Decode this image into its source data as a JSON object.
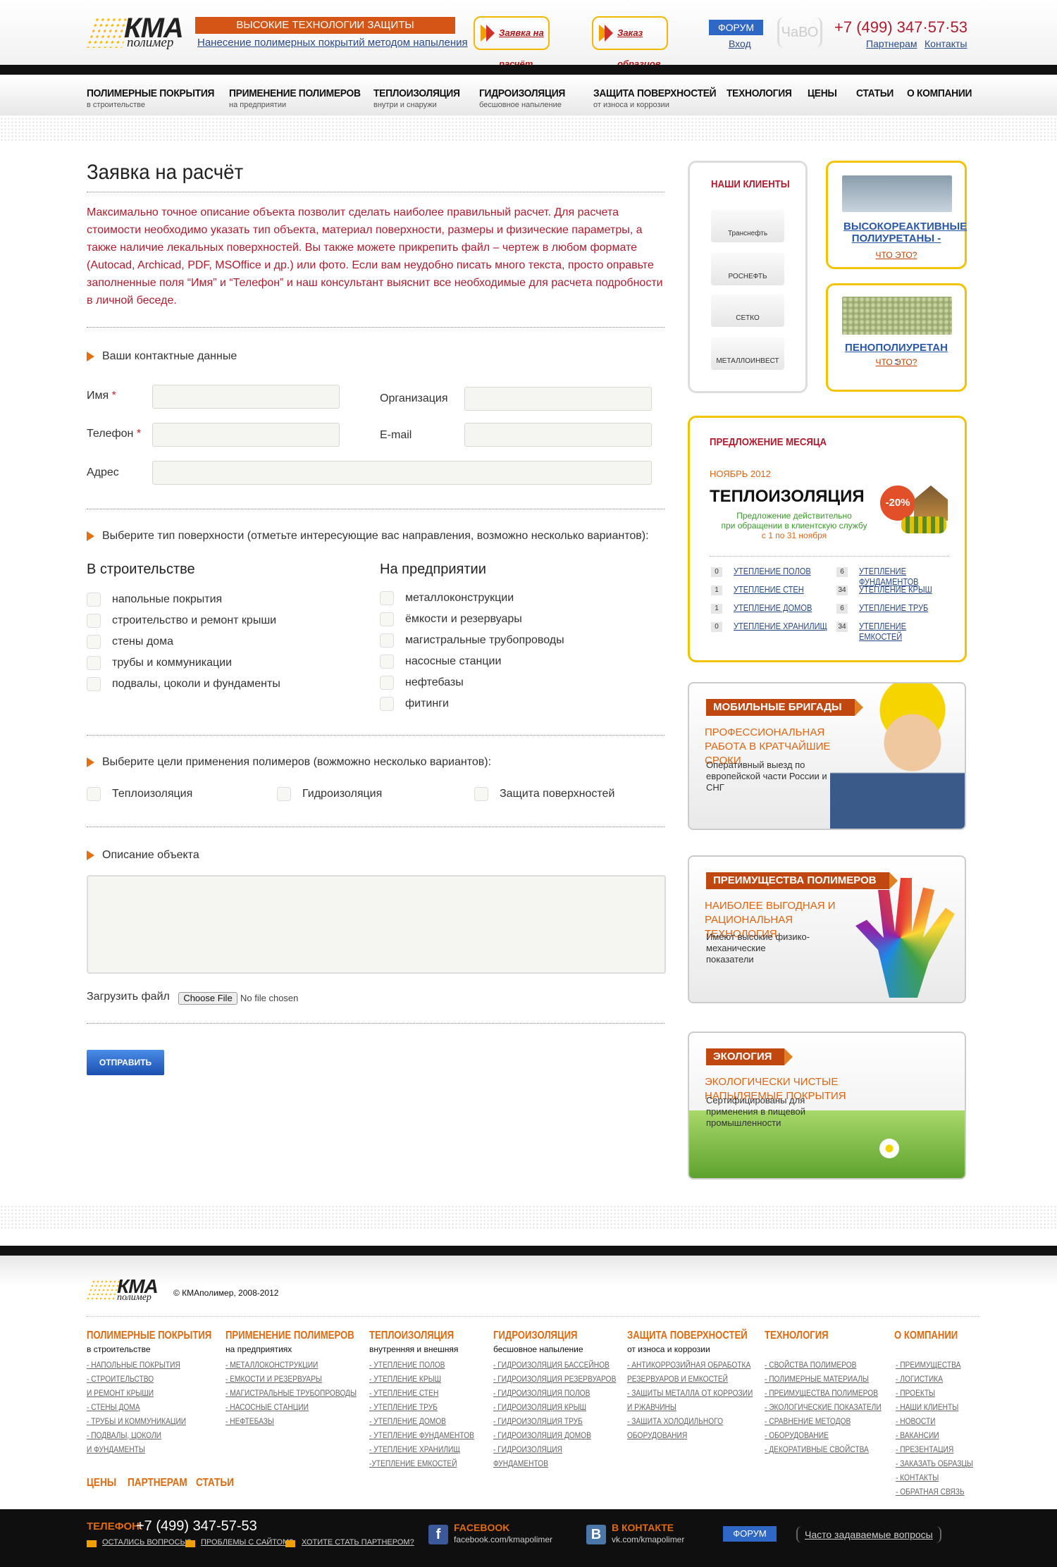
{
  "header": {
    "logo": "КМА",
    "logo_sub": "полимер",
    "slogan": "ВЫСОКИЕ ТЕХНОЛОГИИ ЗАЩИТЫ ПОВЕРХНОСТЕЙ",
    "subslogan": "Нанесение полимерных покрытий методом напыления",
    "btn_request": "Заявка на расчёт",
    "btn_samples": "Заказ образцов",
    "forum": "ФОРУМ",
    "login": "Вход",
    "faq": "ЧаВО",
    "phone": "+7 (499) 347·57·53",
    "partners": "Партнерам",
    "contacts": "Контакты"
  },
  "nav": [
    {
      "label": "ПОЛИМЕРНЫЕ ПОКРЫТИЯ",
      "sub": "в строительстве"
    },
    {
      "label": "ПРИМЕНЕНИЕ ПОЛИМЕРОВ",
      "sub": "на предприятии"
    },
    {
      "label": "ТЕПЛОИЗОЛЯЦИЯ",
      "sub": "внутри и снаружи"
    },
    {
      "label": "ГИДРОИЗОЛЯЦИЯ",
      "sub": "бесшовное напыление"
    },
    {
      "label": "ЗАЩИТА ПОВЕРХНОСТЕЙ",
      "sub": "от износа и коррозии"
    },
    {
      "label": "ТЕХНОЛОГИЯ",
      "sub": ""
    },
    {
      "label": "ЦЕНЫ",
      "sub": ""
    },
    {
      "label": "СТАТЬИ",
      "sub": ""
    },
    {
      "label": "О КОМПАНИИ",
      "sub": ""
    }
  ],
  "form": {
    "title": "Заявка на расчёт",
    "intro": "Максимально точное описание объекта позволит сделать наиболее правильный расчет. Для расчета стоимости необходимо указать тип объекта, материал поверхности, размеры и физические параметры, а также наличие лекальных поверхностей. Вы также можете прикрепить файл – чертеж в любом формате (Autocad, Archicad, PDF, MSOffice и др.) или фото. Если вам неудобно писать много текста, просто оправьте заполненные поля “Имя” и “Телефон” и наш консультант выяснит все необходимые для расчета подробности в личной беседе.",
    "contact_section": "Ваши контактные данные",
    "name": "Имя",
    "phone": "Телефон",
    "org": "Организация",
    "email": "E-mail",
    "address": "Адрес",
    "required_mark": "*",
    "surface_section": "Выберите тип поверхности (отметьте интересующие вас направления, возможно несколько вариантов):",
    "col1_title": "В строительстве",
    "col1": [
      "напольные покрытия",
      "строительство и ремонт крыши",
      "стены дома",
      "трубы и коммуникации",
      "подвалы, цоколи и фундаменты"
    ],
    "col2_title": "На предприятии",
    "col2": [
      "металлоконструкции",
      "ёмкости и резервуары",
      "магистральные трубопроводы",
      "насосные станции",
      "нефтебазы",
      "фитинги"
    ],
    "goals_section": "Выберите цели применения полимеров (вожможно несколько вариантов):",
    "goals": [
      "Теплоизоляция",
      "Гидроизоляция",
      "Защита поверхностей"
    ],
    "descr_section": "Описание объекта",
    "upload_label": "Загрузить файл",
    "choose_file": "Choose File",
    "no_file": "No file chosen",
    "submit": "ОТПРАВИТЬ"
  },
  "sidebar": {
    "clients_title": "НАШИ КЛИЕНТЫ",
    "clients": [
      "Транснефть",
      "РОСНЕФТЬ",
      "СЕТКО",
      "МЕТАЛЛОИНВЕСТ"
    ],
    "card1_title": "ВЫСОКОРЕАКТИВНЫЕ ПОЛИУРЕТАНЫ -",
    "card1_link": "ЧТО ЭТО?",
    "card2_title": "ПЕНОПОЛИУРЕТАН -",
    "card2_link": "ЧТО ЭТО?",
    "offer_title": "ПРЕДЛОЖЕНИЕ МЕСЯЦА",
    "offer_month": "НОЯБРЬ 2012",
    "offer_head": "ТЕПЛОИЗОЛЯЦИЯ",
    "offer_discount": "-20%",
    "offer_text1": "Предложение действительно",
    "offer_text2": "при обращении в клиентскую службу",
    "offer_text3": "с 1 по 31 ноября",
    "offer_links": [
      {
        "n": "0",
        "t": "УТЕПЛЕНИЕ ПОЛОВ"
      },
      {
        "n": "6",
        "t": "УТЕПЛЕНИЕ ФУНДАМЕНТОВ"
      },
      {
        "n": "1",
        "t": "УТЕПЛЕНИЕ СТЕН"
      },
      {
        "n": "34",
        "t": "УТЕПЛЕНИЕ КРЫШ"
      },
      {
        "n": "1",
        "t": "УТЕПЛЕНИЕ ДОМОВ"
      },
      {
        "n": "6",
        "t": "УТЕПЛЕНИЕ ТРУБ"
      },
      {
        "n": "0",
        "t": "УТЕПЛЕНИЕ ХРАНИЛИЩ"
      },
      {
        "n": "34",
        "t": "УТЕПЛЕНИЕ ЕМКОСТЕЙ"
      }
    ],
    "promo1": {
      "tag": "МОБИЛЬНЫЕ БРИГАДЫ",
      "head": "ПРОФЕССИОНАЛЬНАЯ РАБОТА В КРАТЧАЙШИЕ СРОКИ",
      "text": "Оперативный выезд по европейской части России и СНГ"
    },
    "promo2": {
      "tag": "ПРЕИМУЩЕСТВА ПОЛИМЕРОВ",
      "head": "НАИБОЛЕЕ ВЫГОДНАЯ И РАЦИОНАЛЬНАЯ ТЕХНОЛОГИЯ",
      "text": "Имеют высокие физико-механические показатели"
    },
    "promo3": {
      "tag": "ЭКОЛОГИЯ",
      "head": "ЭКОЛОГИЧЕСКИ ЧИСТЫЕ НАПЫЛЯЕМЫЕ ПОКРЫТИЯ",
      "text": "Сертифицированы для применения в пищевой промышленности"
    }
  },
  "footer": {
    "copyright": "© КМАполимер, 2008-2012",
    "cols": [
      {
        "title": "ПОЛИМЕРНЫЕ ПОКРЫТИЯ",
        "sub": "в строительстве",
        "links": [
          "- НАПОЛЬНЫЕ ПОКРЫТИЯ",
          "- СТРОИТЕЛЬСТВО",
          "И РЕМОНТ КРЫШИ",
          "- СТЕНЫ ДОМА",
          "- ТРУБЫ И КОММУНИКАЦИИ",
          "- ПОДВАЛЫ, ЦОКОЛИ",
          "И ФУНДАМЕНТЫ"
        ]
      },
      {
        "title": "ПРИМЕНЕНИЕ ПОЛИМЕРОВ",
        "sub": "на предприятиях",
        "links": [
          "- МЕТАЛЛОКОНСТРУКЦИИ",
          "- ЕМКОСТИ И РЕЗЕРВУАРЫ",
          "- МАГИСТРАЛЬНЫЕ ТРУБОПРОВОДЫ",
          "- НАСОСНЫЕ СТАНЦИИ",
          "- НЕФТЕБАЗЫ"
        ]
      },
      {
        "title": "ТЕПЛОИЗОЛЯЦИЯ",
        "sub": "внутренняя и внешняя",
        "links": [
          "- УТЕПЛЕНИЕ ПОЛОВ",
          "- УТЕПЛЕНИЕ КРЫШ",
          "- УТЕПЛЕНИЕ СТЕН",
          "- УТЕПЛЕНИЕ ТРУБ",
          "- УТЕПЛЕНИЕ ДОМОВ",
          "- УТЕПЛЕНИЕ ФУНДАМЕНТОВ",
          "- УТЕПЛЕНИЕ ХРАНИЛИЩ",
          "-УТЕПЛЕНИЕ ЕМКОСТЕЙ"
        ]
      },
      {
        "title": "ГИДРОИЗОЛЯЦИЯ",
        "sub": "бесшовное напыление",
        "links": [
          "- ГИДРОИЗОЛЯЦИЯ БАССЕЙНОВ",
          "- ГИДРОИЗОЛЯЦИЯ РЕЗЕРВУАРОВ",
          "- ГИДРОИЗОЛЯЦИЯ ПОЛОВ",
          "- ГИДРОИЗОЛЯЦИЯ КРЫШ",
          "- ГИДРОИЗОЛЯЦИЯ ТРУБ",
          "- ГИДРОИЗОЛЯЦИЯ ДОМОВ",
          "- ГИДРОИЗОЛЯЦИЯ",
          "ФУНДАМЕНТОВ"
        ]
      },
      {
        "title": "ЗАЩИТА ПОВЕРХНОСТЕЙ",
        "sub": "от износа и коррозии",
        "links": [
          "- АНТИКОРРОЗИЙНАЯ ОБРАБОТКА",
          "РЕЗЕРВУАРОВ И ЕМКОСТЕЙ",
          "- ЗАЩИТЫ МЕТАЛЛА ОТ КОРРОЗИИ",
          "И РЖАВЧИНЫ",
          "- ЗАЩИТА ХОЛОДИЛЬНОГО",
          "ОБОРУДОВАНИЯ"
        ]
      },
      {
        "title": "ТЕХНОЛОГИЯ",
        "sub": "",
        "links": [
          "- СВОЙСТВА ПОЛИМЕРОВ",
          "- ПОЛИМЕРНЫЕ МАТЕРИАЛЫ",
          "- ПРЕИМУЩЕСТВА ПОЛИМЕРОВ",
          "- ЭКОЛОГИЧЕСКИЕ ПОКАЗАТЕЛИ",
          "- СРАВНЕНИЕ МЕТОДОВ",
          "- ОБОРУДОВАНИЕ",
          "- ДЕКОРАТИВНЫЕ СВОЙСТВА"
        ]
      },
      {
        "title": "О КОМПАНИИ",
        "sub": "",
        "links": [
          "- ПРЕИМУЩЕСТВА",
          "- ЛОГИСТИКА",
          "- ПРОЕКТЫ",
          "- НАШИ КЛИЕНТЫ",
          "- НОВОСТИ",
          "- ВАКАНСИИ",
          "- ПРЕЗЕНТАЦИЯ",
          "- ЗАКАЗАТЬ ОБРАЗЦЫ",
          "- КОНТАКТЫ",
          "- ОБРАТНАЯ СВЯЗЬ"
        ]
      }
    ],
    "bottom_links": [
      "ЦЕНЫ",
      "ПАРТНЕРАМ",
      "СТАТЬИ"
    ],
    "phone_label": "ТЕЛЕФОН:",
    "phone": "+7 (499) 347-57-53",
    "mail1": "ОСТАЛИСЬ ВОПРОСЫ?",
    "mail2": "ПРОБЛЕМЫ С САЙТОМ?",
    "mail3": "ХОТИТЕ СТАТЬ ПАРТНЕРОМ?",
    "fb_title": "FACEBOOK",
    "fb_url": "facebook.com/kmapolimer",
    "vk_title": "В КОНТАКТЕ",
    "vk_url": "vk.com/kmapolimer",
    "forum": "ФОРУМ",
    "faq": "Часто задаваемые вопросы"
  }
}
